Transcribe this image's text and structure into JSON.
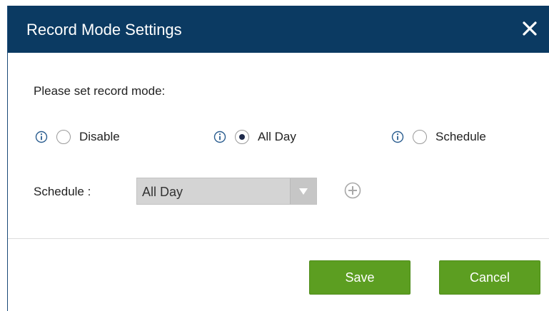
{
  "dialog": {
    "title": "Record Mode Settings",
    "close_icon": "close-icon"
  },
  "prompt": "Please set record mode:",
  "record_modes": [
    {
      "label": "Disable",
      "selected": false,
      "icon": "info-icon"
    },
    {
      "label": "All Day",
      "selected": true,
      "icon": "info-icon"
    },
    {
      "label": "Schedule",
      "selected": false,
      "icon": "info-icon"
    }
  ],
  "schedule": {
    "label": "Schedule :",
    "selected_value": "All Day",
    "add_icon": "plus-circle-icon"
  },
  "buttons": {
    "save_label": "Save",
    "cancel_label": "Cancel"
  },
  "colors": {
    "header_bg": "#0b3a62",
    "button_green": "#5c9e21",
    "select_bg": "#d4d4d4"
  }
}
